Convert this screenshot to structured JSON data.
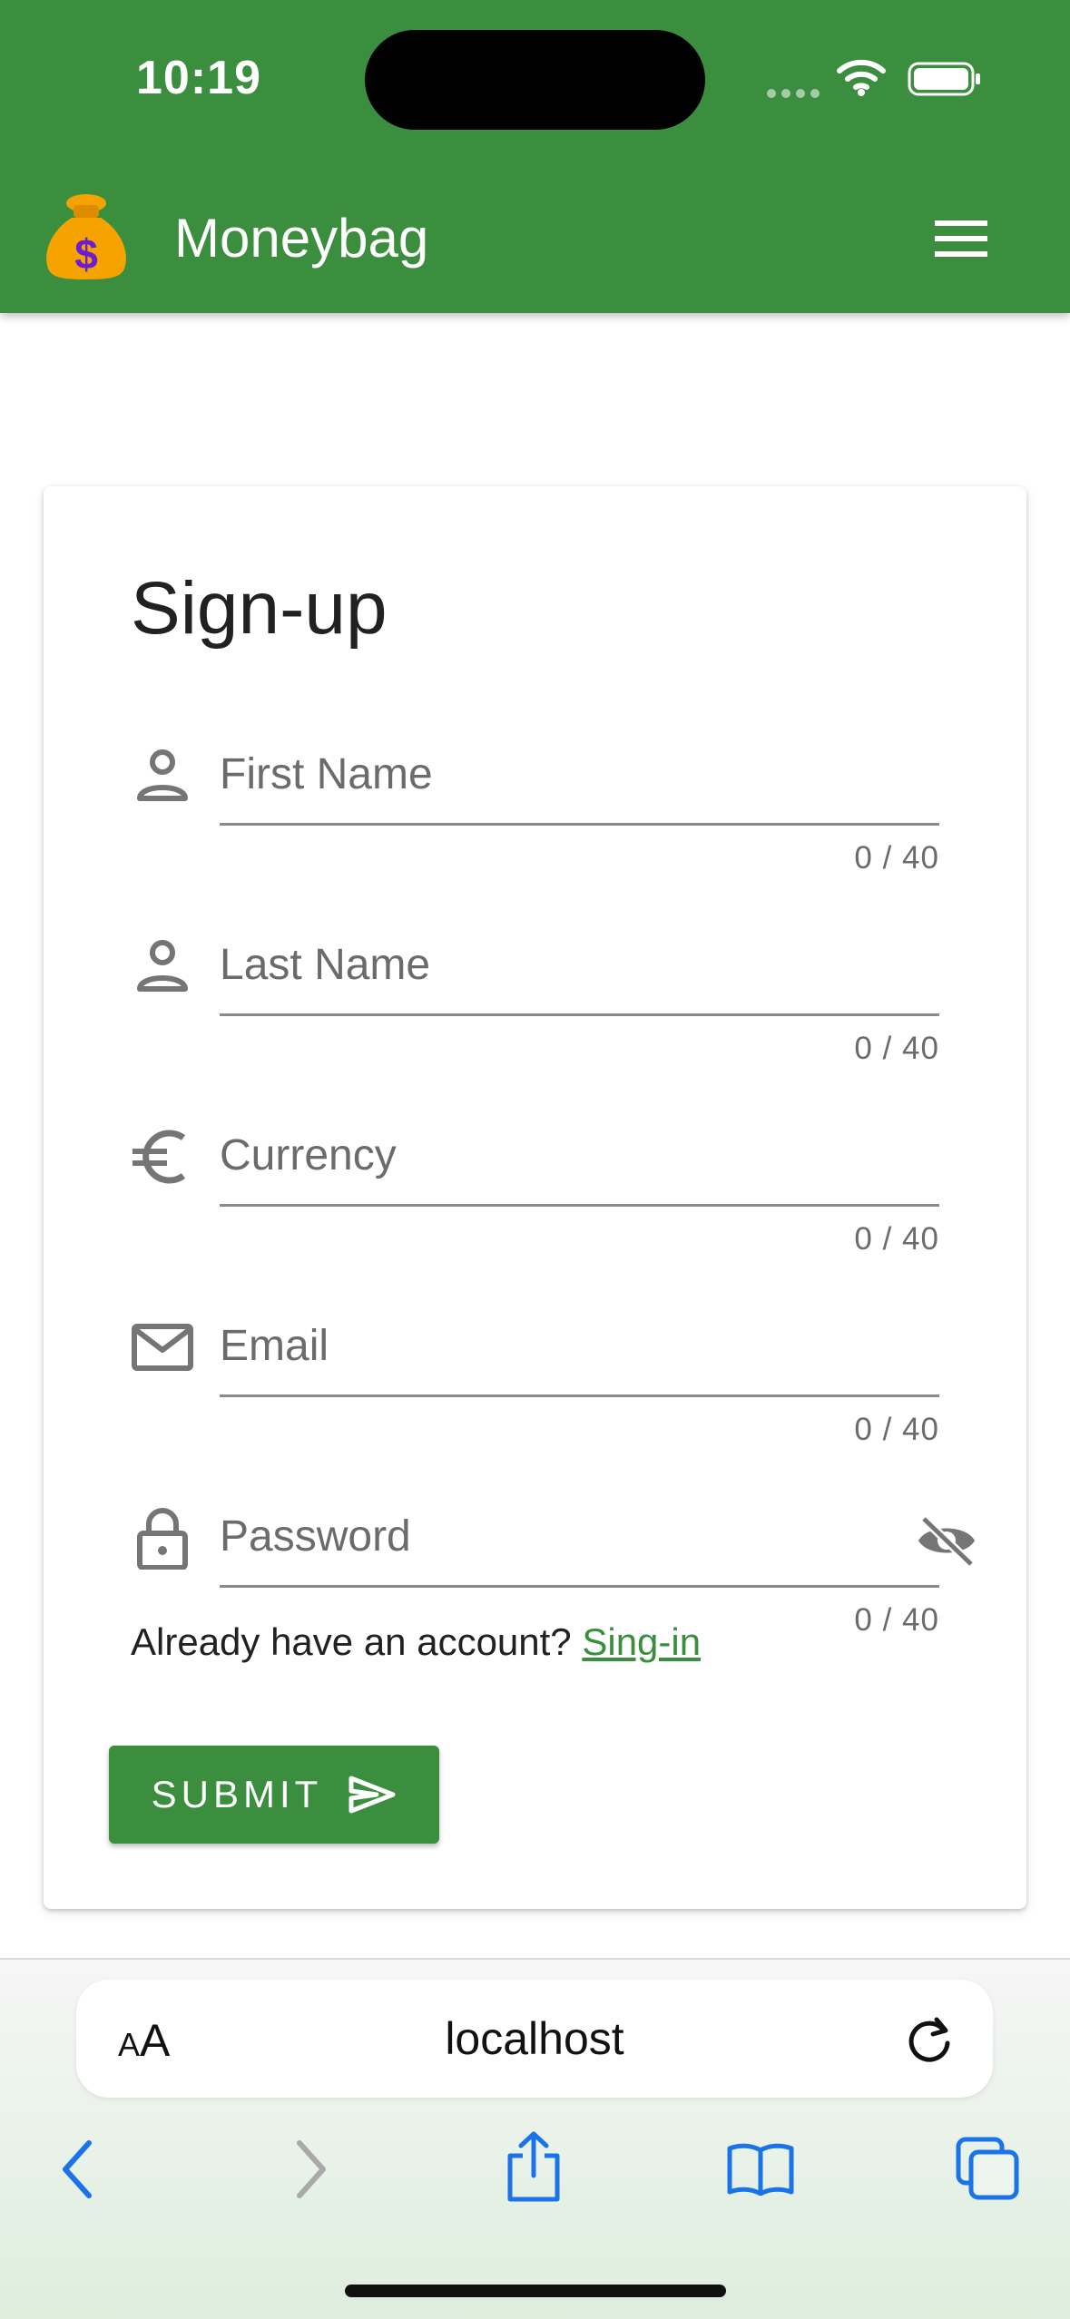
{
  "status_bar": {
    "time": "10:19",
    "icons": [
      "signal-icon",
      "wifi-icon",
      "battery-icon"
    ]
  },
  "app_bar": {
    "title": "Moneybag",
    "logo_icon": "moneybag-icon",
    "menu_icon": "hamburger-menu-icon",
    "background_color": "#3a8e3d"
  },
  "form": {
    "title": "Sign-up",
    "fields": [
      {
        "placeholder": "First Name",
        "value": "",
        "counter": "0 / 40",
        "icon": "person-icon"
      },
      {
        "placeholder": "Last Name",
        "value": "",
        "counter": "0 / 40",
        "icon": "person-icon"
      },
      {
        "placeholder": "Currency",
        "value": "",
        "counter": "0 / 40",
        "icon": "euro-icon"
      },
      {
        "placeholder": "Email",
        "value": "",
        "counter": "0 / 40",
        "icon": "mail-icon"
      },
      {
        "placeholder": "Password",
        "value": "",
        "counter": "0 / 40",
        "icon": "lock-icon",
        "suffix_icon": "eye-off-icon"
      }
    ],
    "signin_prompt": "Already have an account?",
    "signin_link": "Sing-in",
    "submit_label": "SUBMIT",
    "submit_icon": "send-icon",
    "accent_color": "#3a8e3d"
  },
  "browser": {
    "text_size_small": "A",
    "text_size_big": "A",
    "url": "localhost",
    "icons": [
      "reload-icon",
      "back-icon",
      "forward-icon",
      "share-icon",
      "bookmarks-icon",
      "tabs-icon"
    ],
    "accent_color": "#1a73e8"
  }
}
